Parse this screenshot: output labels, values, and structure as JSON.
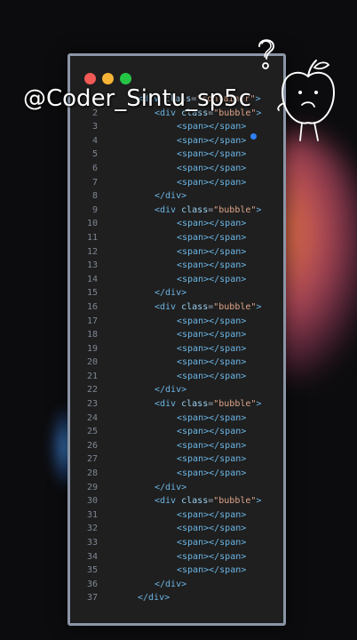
{
  "watermark": "@Coder_Sintu_sp5c",
  "window": {
    "buttons": [
      "close",
      "minimize",
      "maximize"
    ]
  },
  "code": {
    "lines": [
      {
        "n": "1",
        "indent": 0,
        "tokens": [
          [
            "t",
            "<div "
          ],
          [
            "a",
            "class"
          ],
          [
            "p",
            "="
          ],
          [
            "s",
            "\"container\""
          ],
          [
            "t",
            ">"
          ]
        ]
      },
      {
        "n": "2",
        "indent": 1,
        "tokens": [
          [
            "t",
            "<div "
          ],
          [
            "a",
            "class"
          ],
          [
            "p",
            "="
          ],
          [
            "s",
            "\"bubble\""
          ],
          [
            "t",
            ">"
          ]
        ]
      },
      {
        "n": "3",
        "indent": 2,
        "tokens": [
          [
            "t",
            "<span></span>"
          ]
        ]
      },
      {
        "n": "4",
        "indent": 2,
        "tokens": [
          [
            "t",
            "<span></span>"
          ]
        ]
      },
      {
        "n": "5",
        "indent": 2,
        "tokens": [
          [
            "t",
            "<span></span>"
          ]
        ]
      },
      {
        "n": "6",
        "indent": 2,
        "tokens": [
          [
            "t",
            "<span></span>"
          ]
        ]
      },
      {
        "n": "7",
        "indent": 2,
        "tokens": [
          [
            "t",
            "<span></span>"
          ]
        ]
      },
      {
        "n": "8",
        "indent": 1,
        "tokens": [
          [
            "t",
            "</div>"
          ]
        ]
      },
      {
        "n": "9",
        "indent": 1,
        "tokens": [
          [
            "t",
            "<div "
          ],
          [
            "a",
            "class"
          ],
          [
            "p",
            "="
          ],
          [
            "s",
            "\"bubble\""
          ],
          [
            "t",
            ">"
          ]
        ]
      },
      {
        "n": "10",
        "indent": 2,
        "tokens": [
          [
            "t",
            "<span></span>"
          ]
        ]
      },
      {
        "n": "11",
        "indent": 2,
        "tokens": [
          [
            "t",
            "<span></span>"
          ]
        ]
      },
      {
        "n": "12",
        "indent": 2,
        "tokens": [
          [
            "t",
            "<span></span>"
          ]
        ]
      },
      {
        "n": "13",
        "indent": 2,
        "tokens": [
          [
            "t",
            "<span></span>"
          ]
        ]
      },
      {
        "n": "14",
        "indent": 2,
        "tokens": [
          [
            "t",
            "<span></span>"
          ]
        ]
      },
      {
        "n": "15",
        "indent": 1,
        "tokens": [
          [
            "t",
            "</div>"
          ]
        ]
      },
      {
        "n": "16",
        "indent": 1,
        "tokens": [
          [
            "t",
            "<div "
          ],
          [
            "a",
            "class"
          ],
          [
            "p",
            "="
          ],
          [
            "s",
            "\"bubble\""
          ],
          [
            "t",
            ">"
          ]
        ]
      },
      {
        "n": "17",
        "indent": 2,
        "tokens": [
          [
            "t",
            "<span></span>"
          ]
        ]
      },
      {
        "n": "18",
        "indent": 2,
        "tokens": [
          [
            "t",
            "<span></span>"
          ]
        ]
      },
      {
        "n": "19",
        "indent": 2,
        "tokens": [
          [
            "t",
            "<span></span>"
          ]
        ]
      },
      {
        "n": "20",
        "indent": 2,
        "tokens": [
          [
            "t",
            "<span></span>"
          ]
        ]
      },
      {
        "n": "21",
        "indent": 2,
        "tokens": [
          [
            "t",
            "<span></span>"
          ]
        ]
      },
      {
        "n": "22",
        "indent": 1,
        "tokens": [
          [
            "t",
            "</div>"
          ]
        ]
      },
      {
        "n": "23",
        "indent": 1,
        "tokens": [
          [
            "t",
            "<div "
          ],
          [
            "a",
            "class"
          ],
          [
            "p",
            "="
          ],
          [
            "s",
            "\"bubble\""
          ],
          [
            "t",
            ">"
          ]
        ]
      },
      {
        "n": "24",
        "indent": 2,
        "tokens": [
          [
            "t",
            "<span></span>"
          ]
        ]
      },
      {
        "n": "25",
        "indent": 2,
        "tokens": [
          [
            "t",
            "<span></span>"
          ]
        ]
      },
      {
        "n": "26",
        "indent": 2,
        "tokens": [
          [
            "t",
            "<span></span>"
          ]
        ]
      },
      {
        "n": "27",
        "indent": 2,
        "tokens": [
          [
            "t",
            "<span></span>"
          ]
        ]
      },
      {
        "n": "28",
        "indent": 2,
        "tokens": [
          [
            "t",
            "<span></span>"
          ]
        ]
      },
      {
        "n": "29",
        "indent": 1,
        "tokens": [
          [
            "t",
            "</div>"
          ]
        ]
      },
      {
        "n": "30",
        "indent": 1,
        "tokens": [
          [
            "t",
            "<div "
          ],
          [
            "a",
            "class"
          ],
          [
            "p",
            "="
          ],
          [
            "s",
            "\"bubble\""
          ],
          [
            "t",
            ">"
          ]
        ]
      },
      {
        "n": "31",
        "indent": 2,
        "tokens": [
          [
            "t",
            "<span></span>"
          ]
        ]
      },
      {
        "n": "32",
        "indent": 2,
        "tokens": [
          [
            "t",
            "<span></span>"
          ]
        ]
      },
      {
        "n": "33",
        "indent": 2,
        "tokens": [
          [
            "t",
            "<span></span>"
          ]
        ]
      },
      {
        "n": "34",
        "indent": 2,
        "tokens": [
          [
            "t",
            "<span></span>"
          ]
        ]
      },
      {
        "n": "35",
        "indent": 2,
        "tokens": [
          [
            "t",
            "<span></span>"
          ]
        ]
      },
      {
        "n": "36",
        "indent": 1,
        "tokens": [
          [
            "t",
            "</div>"
          ]
        ]
      },
      {
        "n": "37",
        "indent": 0,
        "tokens": [
          [
            "t",
            "</div>"
          ]
        ]
      }
    ]
  }
}
